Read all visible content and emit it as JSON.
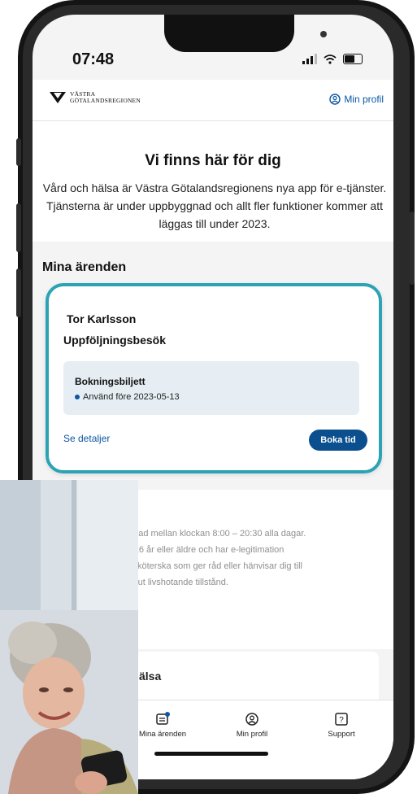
{
  "status_bar": {
    "time": "07:48"
  },
  "header": {
    "logo_line1": "VÄSTRA",
    "logo_line2": "GÖTALANDSREGIONEN",
    "profile_label": "Min profil"
  },
  "hero": {
    "title": "Vi finns här för dig",
    "text": "Vård och hälsa är Västra Götalandsregionens nya app för e-tjänster. Tjänsterna är under uppbyggnad och allt fler funktioner kommer att läggas till under 2023."
  },
  "cases": {
    "section_title": "Mina ärenden",
    "card": {
      "name": "Tor Karlsson",
      "subtitle": "Uppföljningsbesök",
      "ticket_title": "Bokningsbiljett",
      "ticket_date": "Använd före 2023-05-13",
      "details_link": "Se detaljer",
      "book_button": "Boka tid"
    }
  },
  "info": {
    "line1": "nnad mellan klockan 8:00 – 20:30 alla dagar.",
    "line2": "r 16 år eller äldre och har e-legitimation",
    "line3": "ksköterska som ger råd eller hänvisar dig till",
    "line4": "akut livshotande tillstånd."
  },
  "health_card": {
    "title": "älsa"
  },
  "bottom_nav": {
    "items": [
      {
        "label": "Mina ärenden",
        "icon": "inbox-icon"
      },
      {
        "label": "Min profil",
        "icon": "profile-icon"
      },
      {
        "label": "Support",
        "icon": "question-icon"
      }
    ]
  },
  "colors": {
    "accent": "#2ba3b4",
    "brand_blue": "#0b4f8f",
    "link_blue": "#0b57a4"
  }
}
